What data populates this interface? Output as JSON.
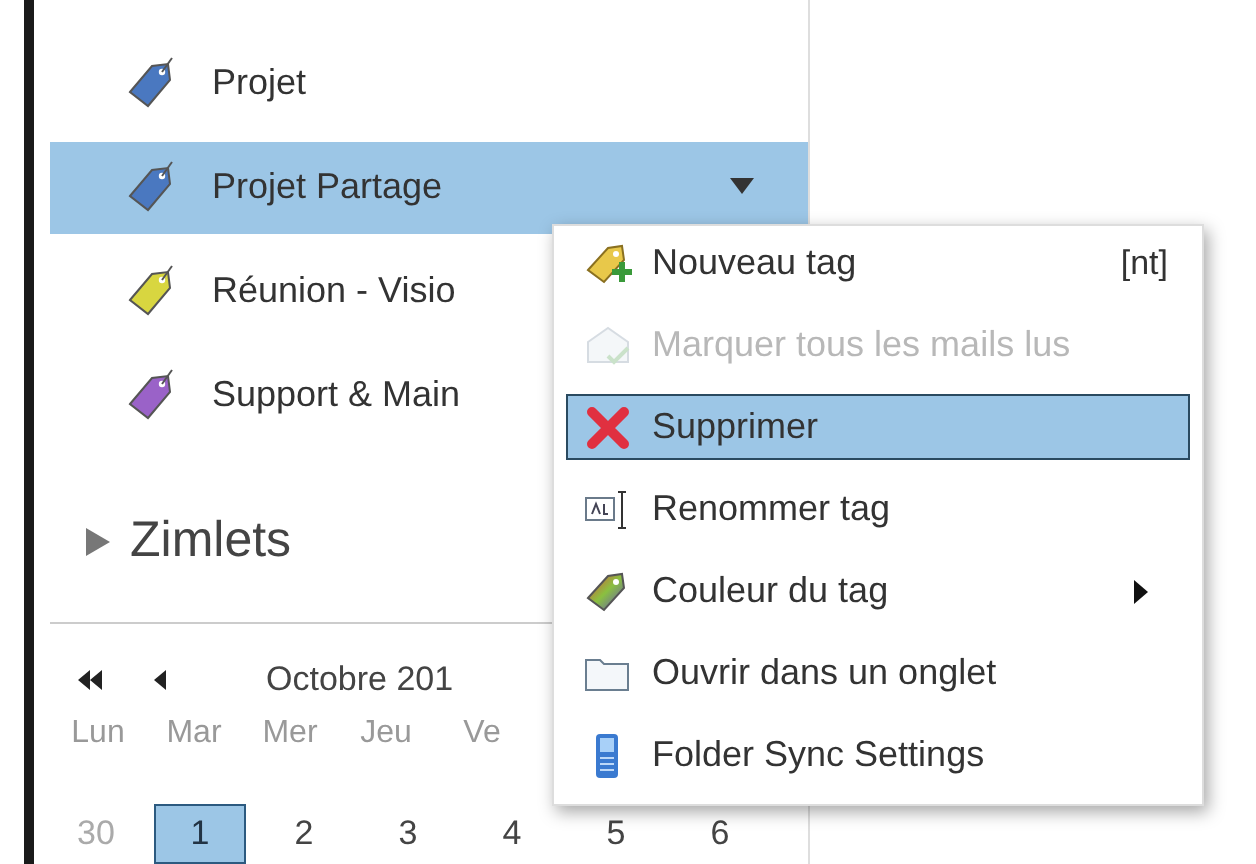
{
  "tags": [
    {
      "label": "Projet",
      "color": "#4a78c0",
      "selected": false
    },
    {
      "label": "Projet Partage",
      "color": "#4a78c0",
      "selected": true
    },
    {
      "label": "Réunion - Visio",
      "color": "#d8d640",
      "selected": false
    },
    {
      "label": "Support & Main",
      "color": "#9a62c8",
      "selected": false
    }
  ],
  "zimlets": {
    "label": "Zimlets",
    "expanded": false
  },
  "calendar": {
    "month": "Octobre 201",
    "weekdays": [
      "Lun",
      "Mar",
      "Mer",
      "Jeu",
      "Ve"
    ],
    "days": [
      {
        "label": "30",
        "selected": false,
        "outside": true
      },
      {
        "label": "1",
        "selected": true,
        "outside": false
      },
      {
        "label": "2",
        "selected": false,
        "outside": false
      },
      {
        "label": "3",
        "selected": false,
        "outside": false
      },
      {
        "label": "4",
        "selected": false,
        "outside": false
      },
      {
        "label": "5",
        "selected": false,
        "outside": false
      },
      {
        "label": "6",
        "selected": false,
        "outside": false
      }
    ]
  },
  "context_menu": {
    "items": [
      {
        "kind": "newtag",
        "label": "Nouveau tag",
        "shortcut": "[nt]",
        "disabled": false,
        "selected": false
      },
      {
        "kind": "markread",
        "label": "Marquer tous les mails lus",
        "disabled": true,
        "selected": false
      },
      {
        "kind": "delete",
        "label": "Supprimer",
        "disabled": false,
        "selected": true
      },
      {
        "kind": "rename",
        "label": "Renommer tag",
        "disabled": false,
        "selected": false
      },
      {
        "kind": "color",
        "label": "Couleur du tag",
        "submenu": true,
        "disabled": false,
        "selected": false
      },
      {
        "kind": "folder",
        "label": "Ouvrir dans un onglet",
        "disabled": false,
        "selected": false
      },
      {
        "kind": "sync",
        "label": "Folder Sync Settings",
        "disabled": false,
        "selected": false
      }
    ]
  }
}
